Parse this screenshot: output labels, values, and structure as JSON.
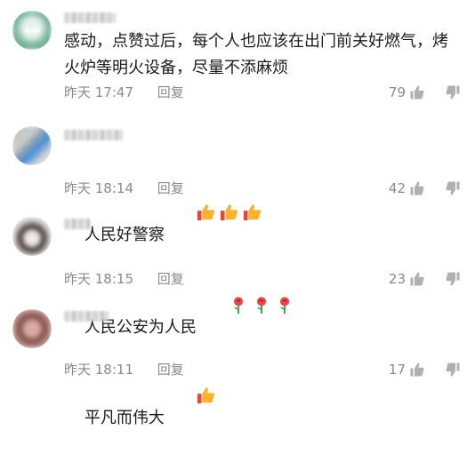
{
  "comments": [
    {
      "text": "感动，点赞过后，每个人也应该在出门前关好燃气，烤火炉等明火设备，尽量不添麻烦",
      "time": "昨天 17:47",
      "reply": "回复",
      "likes": "79",
      "emoji_count": 0
    },
    {
      "text": "人民好警察",
      "time": "昨天 18:14",
      "reply": "回复",
      "likes": "42",
      "emoji_name": "thumbs-up-icon",
      "emoji_count": 3
    },
    {
      "text": "人民公安为人民",
      "time": "昨天 18:15",
      "reply": "回复",
      "likes": "23",
      "emoji_name": "rose-icon",
      "emoji_count": 3
    },
    {
      "text": "平凡而伟大",
      "time": "昨天 18:11",
      "reply": "回复",
      "likes": "17",
      "emoji_name": "thumbs-up-icon",
      "emoji_count": 1
    }
  ],
  "colors": {
    "meta_text": "#8a8a8a",
    "body_text": "#1a1a1a",
    "icon": "#b0b0b0"
  }
}
